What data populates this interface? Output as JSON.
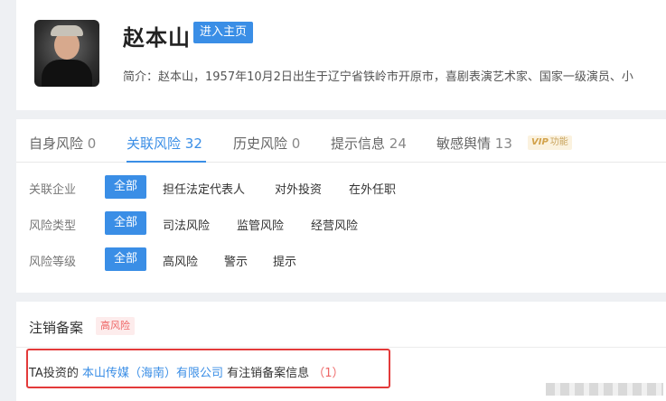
{
  "profile": {
    "name": "赵本山",
    "home_button": "进入主页",
    "intro": "简介：赵本山，1957年10月2日出生于辽宁省铁岭市开原市，喜剧表演艺术家、国家一级演员、小"
  },
  "tabs": [
    {
      "label": "自身风险",
      "count": "0"
    },
    {
      "label": "关联风险",
      "count": "32"
    },
    {
      "label": "历史风险",
      "count": "0"
    },
    {
      "label": "提示信息",
      "count": "24"
    },
    {
      "label": "敏感舆情",
      "count": "13"
    }
  ],
  "vip": {
    "tag": "VIP",
    "text": "功能"
  },
  "filters": [
    {
      "label": "关联企业",
      "options": [
        "全部",
        "担任法定代表人",
        "对外投资",
        "在外任职"
      ],
      "selected": "全部"
    },
    {
      "label": "风险类型",
      "options": [
        "全部",
        "司法风险",
        "监管风险",
        "经营风险"
      ],
      "selected": "全部"
    },
    {
      "label": "风险等级",
      "options": [
        "全部",
        "高风险",
        "警示",
        "提示"
      ],
      "selected": "全部"
    }
  ],
  "cancel": {
    "title": "注销备案",
    "risk_tag": "高风险",
    "prefix": "TA投资的",
    "company": "本山传媒（海南）有限公司",
    "suffix": "有注销备案信息",
    "count": "（1）"
  },
  "colors": {
    "accent": "#3a8ee6",
    "danger": "#e33a3a",
    "vip": "#c9a45e"
  }
}
